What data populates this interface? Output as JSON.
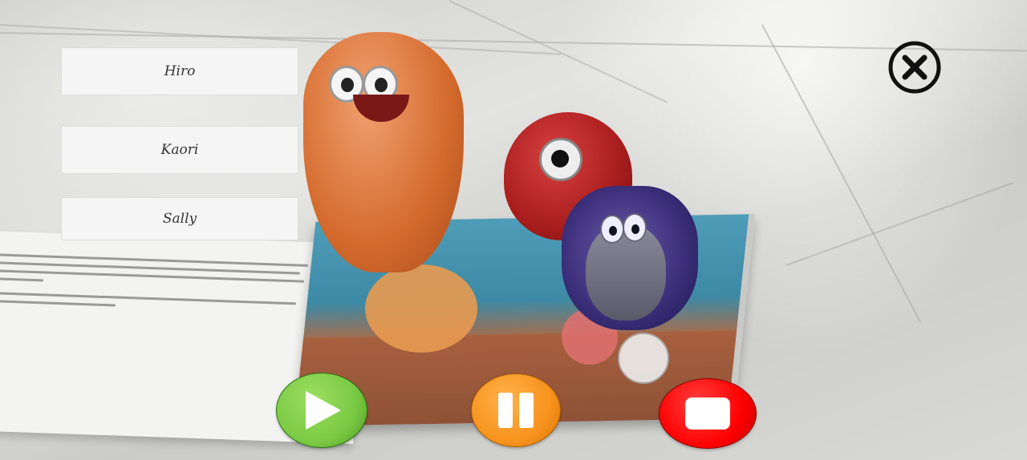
{
  "characters": {
    "buttons": [
      {
        "label": "Hiro"
      },
      {
        "label": "Kaori"
      },
      {
        "label": "Sally"
      }
    ]
  },
  "controls": {
    "play_icon": "play-icon",
    "pause_icon": "pause-icon",
    "stop_icon": "stop-icon",
    "close_icon": "close-circle-icon"
  },
  "colors": {
    "play": "#7ac943",
    "pause": "#f7931e",
    "stop": "#ff0000",
    "close": "#111111",
    "name_button_bg": "#f5f5f5"
  }
}
